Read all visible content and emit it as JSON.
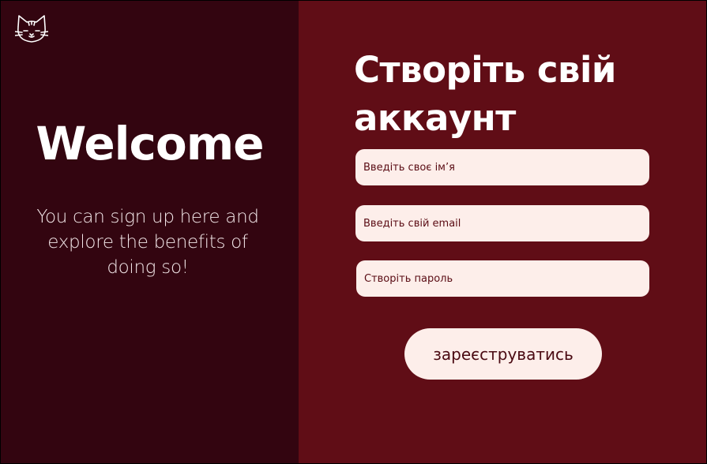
{
  "left_panel": {
    "logo_icon": "cat-face-icon",
    "heading": "Welcome",
    "subtitle": "You can sign up here and explore the benefits of doing so!"
  },
  "form": {
    "title": "Створіть свій аккаунт",
    "name_placeholder": "Введіть своє ім’я",
    "email_placeholder": "Введіть свій email",
    "password_placeholder": "Створіть пароль",
    "submit_label": "зареєструватись"
  },
  "colors": {
    "left_bg": "#330510",
    "right_bg": "#600d16",
    "field_bg": "#fdeeea",
    "field_text": "#5a0c14",
    "text_light": "#ffffff"
  }
}
